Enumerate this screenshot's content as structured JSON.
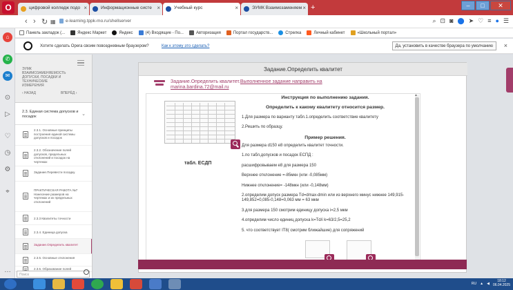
{
  "colors": {
    "opera_red": "#c23a3c",
    "accent": "#a23d6a",
    "bottom_bar": "#8e2a54",
    "taskbar": "#1f4d8b"
  },
  "tabs": [
    {
      "label": "цифровой колледж подо",
      "active": false,
      "favicon_color": "#e8a020"
    },
    {
      "label": "Информационные систе",
      "active": false,
      "favicon_color": "#1d4fa3"
    },
    {
      "label": "Учебный курс",
      "active": true,
      "favicon_color": "#1d4fa3"
    },
    {
      "label": "ЭУМК Взаимозаменяем",
      "active": false,
      "favicon_color": "#1d4fa3"
    }
  ],
  "address": {
    "url": "e-learning.tppk-mo.ru/shellserver"
  },
  "bookmarks": [
    {
      "label": "Панель закладок (...",
      "icon": "bookmarks-panel-icon",
      "color": "#777777"
    },
    {
      "label": "Яндекс Маркет",
      "icon": "market-icon",
      "color": "#333333"
    },
    {
      "label": "Яндекс",
      "icon": "yandex-icon",
      "color": "#111111"
    },
    {
      "label": "(4) Входящие - По...",
      "icon": "mail-icon",
      "color": "#3a7bd5"
    },
    {
      "label": "Авторизация",
      "icon": "auth-icon",
      "color": "#333333"
    },
    {
      "label": "Портал государств...",
      "icon": "gosuslugi-icon",
      "color": "#e06020"
    },
    {
      "label": "Стрелка",
      "icon": "strelka-icon",
      "color": "#1a8fe3"
    },
    {
      "label": "Личный кабинет",
      "icon": "cabinet-icon",
      "color": "#ff5a1f"
    },
    {
      "label": "«Школьный портал»",
      "icon": "school-portal-icon",
      "color": "#e0a020"
    }
  ],
  "notice": {
    "text": "Хотите сделать Opera своим повседневным браузером?",
    "link": "Как к этому это сделать?",
    "button": "Да, установить в качестве браузера по умолчанию"
  },
  "course_nav": {
    "top_title": "ЭУМК ВЗАИМОЗАМЕНЯЕМОСТЬ ДОПУСКИ, ПОСАДКИ И ТЕХНИЧЕСКИЕ ИЗМЕРЕНИЯ",
    "prev_label": "‹ НАЗАД",
    "next_label": "ВПЕРЁД ›",
    "section_title": "2.3. Единая система допусков и посадок",
    "items": [
      {
        "label": "2.3.1. Основные принципы построения единой системы допусков и посадок",
        "active": false
      },
      {
        "label": "2.3.2. Обозначение полей допусков, предельных отклонений и посадок на чертежах",
        "active": false
      },
      {
        "label": "Задание.Перевести посадку.",
        "active": false
      },
      {
        "label": "ПРАКТИЧЕСКАЯ РАБОТА №7 Нанесение размеров на чертежах и их предельных отклонений",
        "active": false
      },
      {
        "label": "2.3.3 Квалитеты точности",
        "active": false
      },
      {
        "label": "2.3.4. Единица допуска",
        "active": false
      },
      {
        "label": "Задание.Определить квалитет",
        "active": true
      },
      {
        "label": "2.3.5. Основные отклонения",
        "active": false
      },
      {
        "label": "2.3.6. Образование полей",
        "active": false
      }
    ],
    "search_placeholder": "Поиск"
  },
  "task": {
    "header": "Задание.Определить квалитет",
    "title": "Задание.Определить квалитет.",
    "title_link": "Выполненное задание направить на",
    "email": "marina.bardina.72@mail.ru",
    "table_caption": "табл. ЕСДП",
    "instructions": [
      {
        "text": "Инструкция по выполнению задания.",
        "heading": true
      },
      {
        "text": "Определить к какому квалитету относится размер.",
        "heading": true
      },
      {
        "text": "1.Для размера по варианту табл.1.определить соответствие квалитету",
        "heading": false
      },
      {
        "text": "2.Решить по образцу.",
        "heading": false
      },
      {
        "text": "Пример решения.",
        "heading": true
      },
      {
        "text": "Для размера d150 e8 определить квалитет точности.",
        "heading": false
      },
      {
        "text": "1.по табл.допусков и посадок ЕСПД :",
        "heading": false
      },
      {
        "text": "расшифровываем e8 для размера 150",
        "heading": false
      },
      {
        "text": "Верхнее отклонение =-85мкн (или -0,085мм)",
        "heading": false
      },
      {
        "text": "Нижнее отклонение= -148мкн (или -0,148мм)",
        "heading": false
      },
      {
        "text": "2.определим допуск размера Td=dmax-dmin или из верхнего минус нижнее 149,915-149,852=0,085-0,148=0,063 мм = 63 мкм",
        "heading": false
      },
      {
        "text": "3.для размера 150 смотрим единицу допуска i=2,5 мкм",
        "heading": false
      },
      {
        "text": "4.определим число единиц допуска k=Td/i k=63/2,5=25,2",
        "heading": false
      },
      {
        "text": "5. что соответствует IT8( смотрим ближайшие) для сопряжений",
        "heading": false
      }
    ]
  },
  "taskbar": {
    "lang": "RU",
    "time": "18:12",
    "date": "06.04.2025"
  }
}
